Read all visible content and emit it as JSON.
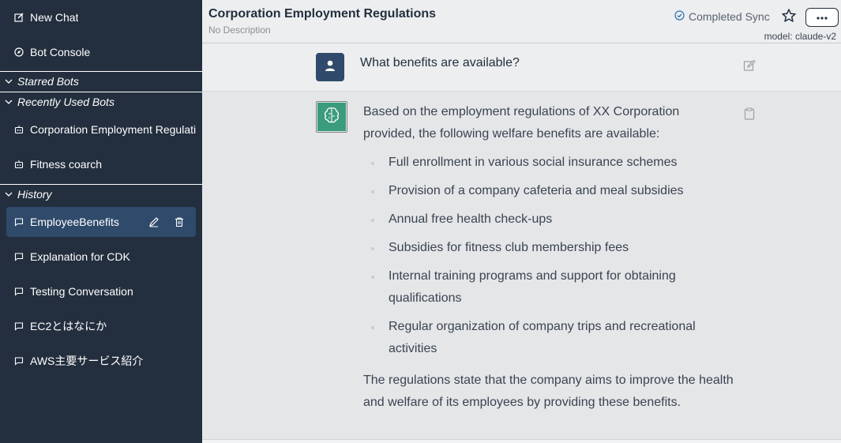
{
  "sidebar": {
    "new_chat": "New Chat",
    "bot_console": "Bot Console",
    "starred_bots": "Starred Bots",
    "recently_used_bots": "Recently Used Bots",
    "recent_bots": [
      "Corporation Employment Regulations",
      "Fitness coarch"
    ],
    "history_label": "History",
    "history": [
      "EmployeeBenefits",
      "Explanation for CDK",
      "Testing Conversation",
      "EC2とはなにか",
      "AWS主要サービス紹介"
    ]
  },
  "header": {
    "title": "Corporation Employment Regulations",
    "description": "No Description",
    "sync_status": "Completed Sync",
    "model": "model: claude-v2"
  },
  "chat": {
    "user_message": "What benefits are available?",
    "bot_intro": "Based on the employment regulations of XX Corporation provided, the following welfare benefits are available:",
    "bot_list": [
      "Full enrollment in various social insurance schemes",
      "Provision of a company cafeteria and meal subsidies",
      "Annual free health check-ups",
      "Subsidies for fitness club membership fees",
      "Internal training programs and support for obtaining qualifications",
      "Regular organization of company trips and recreational activities"
    ],
    "bot_conclusion": "The regulations state that the company aims to improve the health and welfare of its employees by providing these benefits."
  },
  "colors": {
    "sidebar_bg": "#232f3e",
    "active_item_bg": "#2f4a6b",
    "bot_avatar": "#3b9b7d",
    "user_avatar": "#2f4a6b"
  },
  "icons": {
    "new_chat": "edit-square-icon",
    "bot_console": "compass-icon",
    "chevron": "chevron-down-icon",
    "bot": "robot-icon",
    "chat": "chat-bubble-icon",
    "rename": "pencil-icon",
    "delete": "trash-icon",
    "sync": "check-circle-icon",
    "star": "star-icon",
    "more": "ellipsis-icon",
    "user": "user-icon",
    "bot_avatar": "brain-icon",
    "edit": "edit-icon",
    "copy": "clipboard-icon"
  }
}
